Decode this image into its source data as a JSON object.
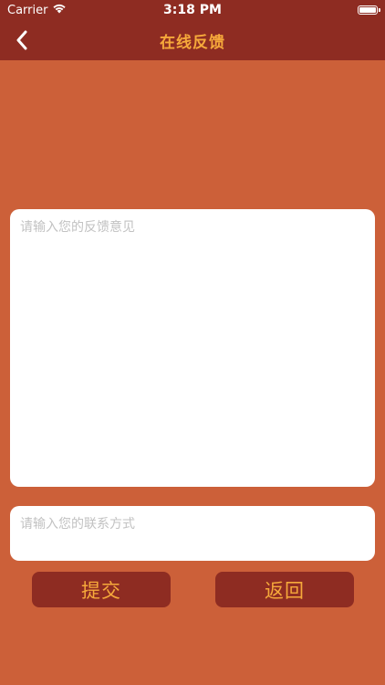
{
  "status_bar": {
    "carrier": "Carrier",
    "time": "3:18 PM",
    "wifi_icon": "wifi-icon",
    "battery_icon": "battery-icon"
  },
  "nav": {
    "back_icon": "chevron-left-icon",
    "title": "在线反馈"
  },
  "form": {
    "feedback_placeholder": "请输入您的反馈意见",
    "feedback_value": "",
    "contact_placeholder": "请输入您的联系方式",
    "contact_value": ""
  },
  "actions": {
    "submit_label": "提交",
    "return_label": "返回"
  },
  "colors": {
    "background": "#cc6039",
    "bar": "#8e2c22",
    "accent": "#f6a93b",
    "input_bg": "#ffffff"
  }
}
